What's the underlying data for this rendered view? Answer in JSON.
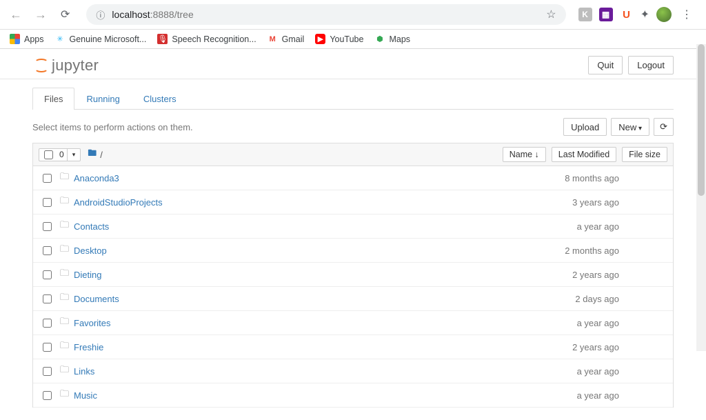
{
  "browser": {
    "url_host": "localhost",
    "url_port_path": ":8888/tree"
  },
  "bookmarks": [
    {
      "label": "Apps",
      "icon": "apps"
    },
    {
      "label": "Genuine Microsoft...",
      "icon": "ms"
    },
    {
      "label": "Speech Recognition...",
      "icon": "sr"
    },
    {
      "label": "Gmail",
      "icon": "gmail"
    },
    {
      "label": "YouTube",
      "icon": "yt"
    },
    {
      "label": "Maps",
      "icon": "maps"
    }
  ],
  "header": {
    "brand": "jupyter",
    "quit": "Quit",
    "logout": "Logout"
  },
  "tabs": {
    "files": "Files",
    "running": "Running",
    "clusters": "Clusters"
  },
  "toolbar": {
    "hint": "Select items to perform actions on them.",
    "upload": "Upload",
    "new": "New",
    "selected_count": "0",
    "breadcrumb_root": "/",
    "col_name": "Name",
    "col_modified": "Last Modified",
    "col_size": "File size"
  },
  "files": [
    {
      "name": "Anaconda3",
      "modified": "8 months ago"
    },
    {
      "name": "AndroidStudioProjects",
      "modified": "3 years ago"
    },
    {
      "name": "Contacts",
      "modified": "a year ago"
    },
    {
      "name": "Desktop",
      "modified": "2 months ago"
    },
    {
      "name": "Dieting",
      "modified": "2 years ago"
    },
    {
      "name": "Documents",
      "modified": "2 days ago"
    },
    {
      "name": "Favorites",
      "modified": "a year ago"
    },
    {
      "name": "Freshie",
      "modified": "2 years ago"
    },
    {
      "name": "Links",
      "modified": "a year ago"
    },
    {
      "name": "Music",
      "modified": "a year ago"
    }
  ]
}
